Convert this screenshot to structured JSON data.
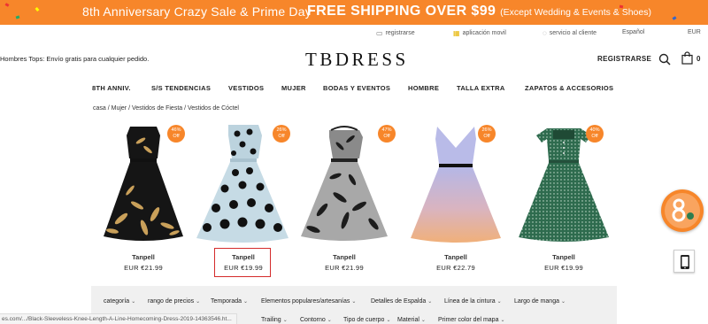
{
  "promo": {
    "left_text": "8th Anniversary Crazy Sale & Prime Day",
    "right_text": "FREE SHIPPING OVER $99",
    "right_note": "(Except Wedding & Events & Shoes)"
  },
  "utility": {
    "register": "registrarse",
    "app": "aplicación movil",
    "service": "servicio al cliente",
    "language": "Español",
    "currency": "EUR"
  },
  "header": {
    "shipping_note": "Hombres Tops: Envío gratis para cualquier pedido.",
    "logo": "TBDRESS",
    "register": "REGISTRARSE",
    "cart_count": "0"
  },
  "nav": [
    "8TH ANNIV.",
    "S/S TENDENCIAS",
    "VESTIDOS",
    "MUJER",
    "BODAS Y EVENTOS",
    "HOMBRE",
    "TALLA EXTRA",
    "ZAPATOS & ACCESORIOS"
  ],
  "breadcrumb": "casa / Mujer / Vestidos de Fiesta / Vestidos de Cóctel",
  "products": [
    {
      "badge_pct": "46%",
      "badge_off": "Off",
      "brand": "Tanpell",
      "price": "EUR €21.99"
    },
    {
      "badge_pct": "26%",
      "badge_off": "Off",
      "brand": "Tanpell",
      "price": "EUR €19.99"
    },
    {
      "badge_pct": "47%",
      "badge_off": "Off",
      "brand": "Tanpell",
      "price": "EUR €21.99"
    },
    {
      "badge_pct": "26%",
      "badge_off": "Off",
      "brand": "Tanpell",
      "price": "EUR €22.79"
    },
    {
      "badge_pct": "40%",
      "badge_off": "Off",
      "brand": "Tanpell",
      "price": "EUR €19.99"
    }
  ],
  "filters_row1": [
    "categoría",
    "rango de precios",
    "Temporada",
    "Elementos populares/artesanías",
    "Detalles de Espalda",
    "Línea de la cintura",
    "Largo de manga"
  ],
  "filters_row2": [
    "Trailing",
    "Contorno",
    "Tipo de cuerpo",
    "Material",
    "Primer color del mapa"
  ],
  "status_url": "es.com/.../Black-Sleeveless-Knee-Length-A-Line-Homecoming-Dress-2019-14363546.ht...",
  "colors": {
    "accent": "#f7862a",
    "highlight": "#d42b2b"
  }
}
